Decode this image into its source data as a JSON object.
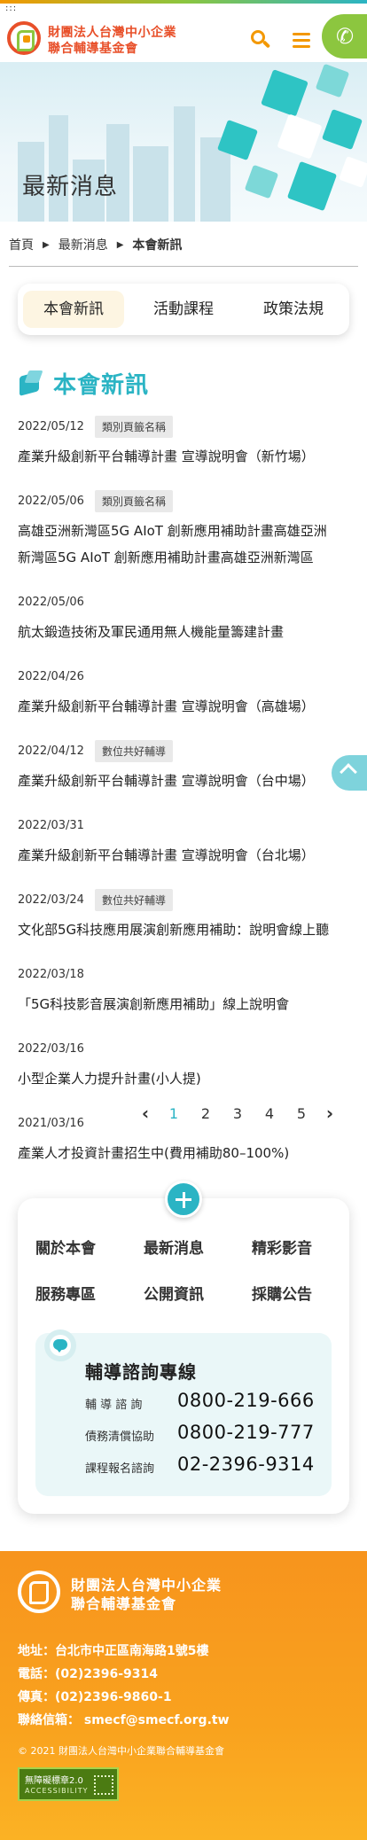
{
  "header": {
    "skip_link": ":::",
    "org_name_line1": "財團法人台灣中小企業",
    "org_name_line2": "聯合輔導基金會",
    "phone_glyph": "✆"
  },
  "banner": {
    "title": "最新消息"
  },
  "breadcrumb": {
    "home": "首頁",
    "section": "最新消息",
    "current": "本會新訊",
    "sep": "▶"
  },
  "tabs": [
    {
      "label": "本會新訊",
      "active": true
    },
    {
      "label": "活動課程",
      "active": false
    },
    {
      "label": "政策法規",
      "active": false
    }
  ],
  "section": {
    "title": "本會新訊"
  },
  "news": [
    {
      "date": "2022/05/12",
      "category": "類別頁籤名稱",
      "title_lines": [
        "產業升級創新平台輔導計畫 宣導說明會（新竹場）"
      ]
    },
    {
      "date": "2022/05/06",
      "category": "類別頁籤名稱",
      "title_lines": [
        "高雄亞洲新灣區5G AIoT 創新應用補助計畫高雄亞洲",
        "新灣區5G AIoT 創新應用補助計畫高雄亞洲新灣區"
      ]
    },
    {
      "date": "2022/05/06",
      "category": "",
      "title_lines": [
        "航太鍛造技術及軍民通用無人機能量籌建計畫"
      ]
    },
    {
      "date": "2022/04/26",
      "category": "",
      "title_lines": [
        "產業升級創新平台輔導計畫 宣導說明會（高雄場）"
      ]
    },
    {
      "date": "2022/04/12",
      "category": "數位共好輔導",
      "title_lines": [
        "產業升級創新平台輔導計畫 宣導說明會（台中場）"
      ]
    },
    {
      "date": "2022/03/31",
      "category": "",
      "title_lines": [
        "產業升級創新平台輔導計畫 宣導說明會（台北場）"
      ]
    },
    {
      "date": "2022/03/24",
      "category": "數位共好輔導",
      "title_lines": [
        "文化部5G科技應用展演創新應用補助：說明會線上聽"
      ]
    },
    {
      "date": "2022/03/18",
      "category": "",
      "title_lines": [
        "「5G科技影音展演創新應用補助」線上說明會"
      ]
    },
    {
      "date": "2022/03/16",
      "category": "",
      "title_lines": [
        "小型企業人力提升計畫(小人提)"
      ]
    },
    {
      "date": "2021/03/16",
      "category": "",
      "title_lines": [
        "產業人才投資計畫招生中(費用補助80–100%)"
      ]
    }
  ],
  "pagination": {
    "prev": "‹",
    "next": "›",
    "pages": [
      "1",
      "2",
      "3",
      "4",
      "5"
    ],
    "current": "1"
  },
  "footer_menu": {
    "links": [
      "關於本會",
      "最新消息",
      "精彩影音",
      "服務專區",
      "公開資訊",
      "採購公告"
    ]
  },
  "consult": {
    "title": "輔導諮詢專線",
    "lines": [
      {
        "label": "輔 導 諮 詢",
        "number": "0800-219-666"
      },
      {
        "label": "債務清償協助",
        "number": "0800-219-777"
      },
      {
        "label": "課程報名諮詢",
        "number": "02-2396-9314"
      }
    ]
  },
  "footer": {
    "org_line1": "財團法人台灣中小企業",
    "org_line2": "聯合輔導基金會",
    "address": "地址：台北市中正區南海路1號5樓",
    "phone": "電話：(02)2396-9314",
    "fax": "傳真：(02)2396-9860-1",
    "email": "聯絡信箱： smecf@smecf.org.tw",
    "copyright": "© 2021 財團法人台灣中小企業聯合輔導基金會",
    "accessibility_line1": "無障礙標章2.0",
    "accessibility_line2": "ACCESSIBILITY"
  },
  "colors": {
    "brand_orange": "#f39800",
    "brand_green": "#8cc63f",
    "brand_teal": "#2bb4c4",
    "logo_red": "#e8502a"
  },
  "icons": [
    "search-icon",
    "menu-icon",
    "phone-icon",
    "chevron-left-icon",
    "chevron-right-icon",
    "plus-icon",
    "chat-icon",
    "arrow-up-icon"
  ]
}
